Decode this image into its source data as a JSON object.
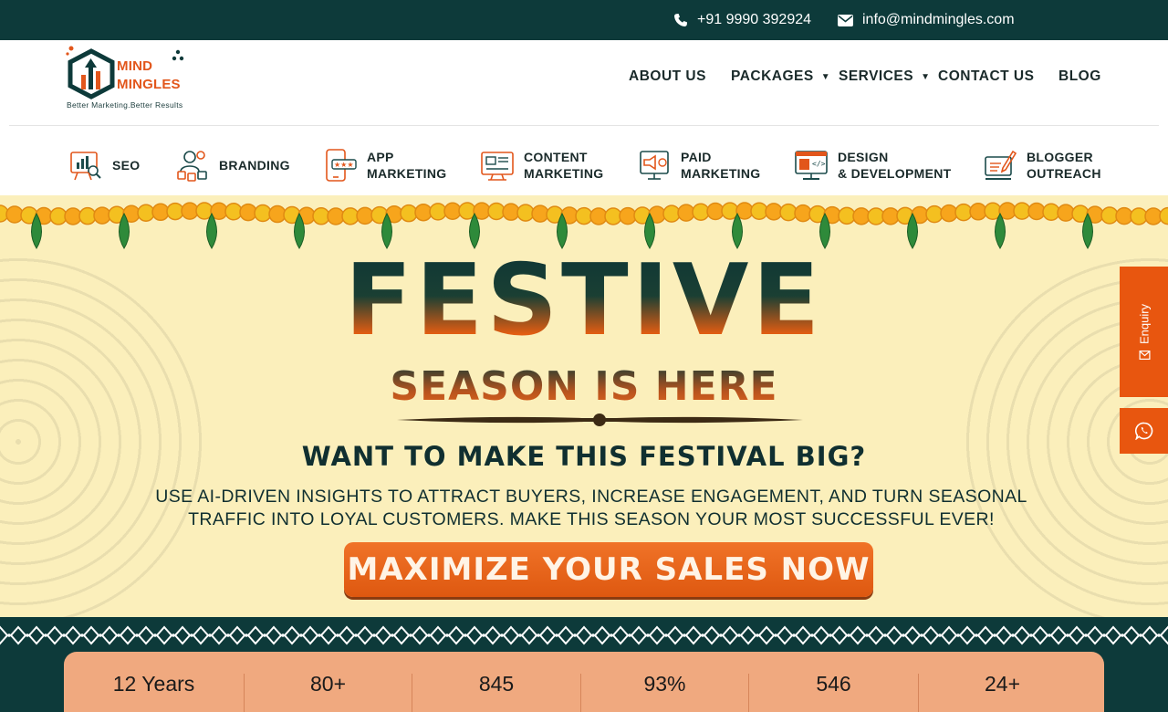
{
  "topbar": {
    "phone": "+91 9990 392924",
    "email": "info@mindmingles.com"
  },
  "logo": {
    "line1": "MIND",
    "line2": "MINGLES",
    "tagline": "Better Marketing.Better Results"
  },
  "nav": {
    "items": [
      {
        "label": "ABOUT US"
      },
      {
        "label": "PACKAGES"
      },
      {
        "label": "SERVICES"
      },
      {
        "label": "CONTACT US"
      },
      {
        "label": "BLOG"
      }
    ]
  },
  "services": [
    {
      "line1": "SEO",
      "line2": "",
      "icon": "seo-icon"
    },
    {
      "line1": "BRANDING",
      "line2": "",
      "icon": "branding-icon"
    },
    {
      "line1": "APP",
      "line2": "MARKETING",
      "icon": "app-marketing-icon"
    },
    {
      "line1": "CONTENT",
      "line2": "MARKETING",
      "icon": "content-marketing-icon"
    },
    {
      "line1": "PAID",
      "line2": "MARKETING",
      "icon": "paid-marketing-icon"
    },
    {
      "line1": "DESIGN",
      "line2": "& DEVELOPMENT",
      "icon": "design-development-icon"
    },
    {
      "line1": "BLOGGER",
      "line2": "OUTREACH",
      "icon": "blogger-outreach-icon"
    }
  ],
  "hero": {
    "title": "FESTIVE",
    "subtitle": "SEASON IS HERE",
    "question": "WANT TO MAKE THIS FESTIVAL BIG?",
    "body_line1": "USE AI-DRIVEN INSIGHTS TO ATTRACT BUYERS, INCREASE ENGAGEMENT, AND TURN SEASONAL",
    "body_line2": "TRAFFIC INTO LOYAL CUSTOMERS. MAKE THIS SEASON YOUR MOST SUCCESSFUL EVER!",
    "cta": "MAXIMIZE YOUR SALES NOW"
  },
  "side": {
    "enquiry": "Enquiry"
  },
  "stats": [
    "12 Years",
    "80+",
    "845",
    "93%",
    "546",
    "24+"
  ],
  "colors": {
    "dark_teal": "#0d3a3a",
    "accent_orange": "#e8560f",
    "hero_bg": "#fbefbb",
    "stats_bg": "#f0a97f"
  }
}
